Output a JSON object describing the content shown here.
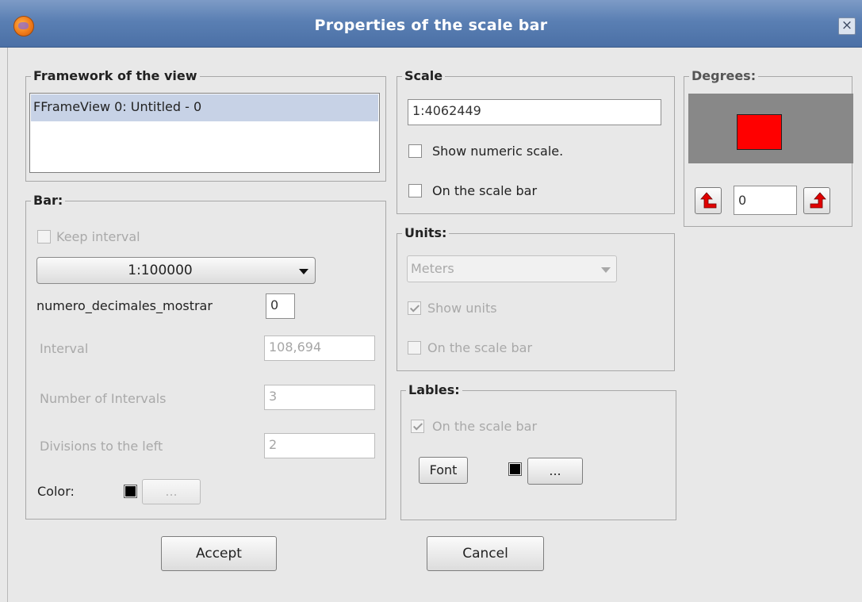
{
  "window": {
    "title": "Properties of the scale bar",
    "close_glyph": "×"
  },
  "framework": {
    "title": "Framework of the view",
    "items": [
      "FFrameView 0: Untitled - 0"
    ]
  },
  "bar": {
    "title": "Bar:",
    "keep_interval_label": "Keep interval",
    "keep_interval_checked": false,
    "scale_combo_value": "1:100000",
    "decimals_label": "numero_decimales_mostrar",
    "decimals_value": "0",
    "interval_label": "Interval",
    "interval_value": "108,694",
    "num_intervals_label": "Number of Intervals",
    "num_intervals_value": "3",
    "divisions_left_label": "Divisions to the left",
    "divisions_left_value": "2",
    "color_label": "Color:",
    "color_value": "#000000",
    "color_button_label": "..."
  },
  "scale": {
    "title": "Scale",
    "value": "1:4062449",
    "show_numeric_label": "Show numeric scale.",
    "show_numeric_checked": false,
    "on_scale_bar_label": "On the scale bar",
    "on_scale_bar_checked": false
  },
  "units": {
    "title": "Units:",
    "combo_value": "Meters",
    "show_units_label": "Show units",
    "show_units_checked": true,
    "on_scale_bar_label": "On the scale bar",
    "on_scale_bar_checked": false
  },
  "labels": {
    "title": "Lables:",
    "on_scale_bar_label": "On the scale bar",
    "on_scale_bar_checked": true,
    "font_button_label": "Font",
    "color_value": "#000000",
    "color_button_label": "..."
  },
  "degrees": {
    "title": "Degrees:",
    "value": "0",
    "preview_bg": "#888888",
    "preview_fill": "#ff0000",
    "rotate_left_icon": "rotate-left-arrow-icon",
    "rotate_right_icon": "rotate-right-arrow-icon"
  },
  "footer": {
    "accept_label": "Accept",
    "cancel_label": "Cancel"
  }
}
